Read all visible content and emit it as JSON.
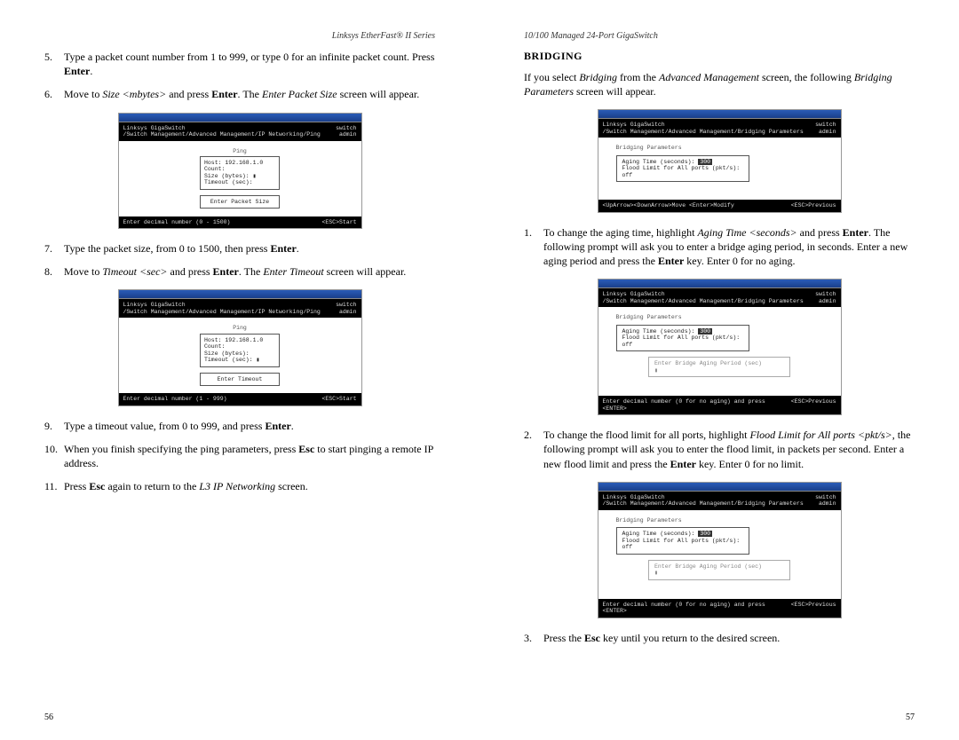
{
  "left": {
    "running_head": "Linksys EtherFast® II Series",
    "page_num": "56",
    "steps": {
      "n5": "5.",
      "s5a": "Type a packet count number from 1 to 999, or type 0 for an infinite packet count. Press ",
      "s5b": "Enter",
      "s5c": ".",
      "n6": "6.",
      "s6a": "Move to ",
      "s6b": "Size <mbytes>",
      "s6c": " and press ",
      "s6d": "Enter",
      "s6e": ". The ",
      "s6f": "Enter Packet Size",
      "s6g": " screen will appear.",
      "n7": "7.",
      "s7a": "Type the packet size, from 0 to 1500, then press ",
      "s7b": "Enter",
      "s7c": ".",
      "n8": "8.",
      "s8a": "Move to ",
      "s8b": "Timeout <sec>",
      "s8c": " and press ",
      "s8d": "Enter",
      "s8e": ". The ",
      "s8f": "Enter Timeout",
      "s8g": " screen will appear.",
      "n9": "9.",
      "s9a": "Type a timeout value, from 0 to 999, and press ",
      "s9b": "Enter",
      "s9c": ".",
      "n10": "10.",
      "s10a": "When you finish specifying the ping parameters, press ",
      "s10b": "Esc",
      "s10c": " to start pinging a remote IP address.",
      "n11": "11.",
      "s11a": "Press ",
      "s11b": "Esc",
      "s11c": " again to return to the ",
      "s11d": "L3 IP Networking",
      "s11e": " screen."
    },
    "ss1": {
      "head_l": "Linksys GigaSwitch\n/Switch Management/Advanced Management/IP Networking/Ping",
      "head_r": "switch\nadmin",
      "label": "Ping",
      "box1": "Host: 192.168.1.0\nCount:\nSize (bytes): ▮\nTimeout (sec):",
      "box2": "Enter Packet Size",
      "foot_l": "Enter decimal number (0 - 1500)",
      "foot_r": "<ESC>Start"
    },
    "ss2": {
      "head_l": "Linksys GigaSwitch\n/Switch Management/Advanced Management/IP Networking/Ping",
      "head_r": "switch\nadmin",
      "label": "Ping",
      "box1": "Host: 192.168.1.0\nCount:\nSize (bytes):\nTimeout (sec): ▮",
      "box2": "Enter Timeout",
      "foot_l": "Enter decimal number (1 - 999)",
      "foot_r": "<ESC>Start"
    }
  },
  "right": {
    "running_head": "10/100 Managed 24-Port GigaSwitch",
    "page_num": "57",
    "heading": "BRIDGING",
    "intro_a": "If you select ",
    "intro_b": "Bridging",
    "intro_c": " from the ",
    "intro_d": "Advanced Management",
    "intro_e": " screen, the following ",
    "intro_f": "Bridging Parameters",
    "intro_g": " screen will appear.",
    "steps": {
      "n1": "1.",
      "s1a": "To change the aging time, highlight ",
      "s1b": "Aging Time <seconds>",
      "s1c": " and press ",
      "s1d": "Enter",
      "s1e": ". The following prompt will ask you to enter a bridge aging period, in seconds. Enter a new aging period and press the ",
      "s1f": "Enter",
      "s1g": " key. Enter 0 for no aging.",
      "n2": "2.",
      "s2a": "To change the flood limit for all ports, highlight ",
      "s2b": "Flood Limit for All ports <pkt/s>",
      "s2c": ", the following prompt will ask you to enter the flood limit, in packets per second. Enter a new flood limit and press the ",
      "s2d": "Enter",
      "s2e": " key. Enter 0 for no limit.",
      "n3": "3.",
      "s3a": "Press the ",
      "s3b": "Esc",
      "s3c": " key until you return to the desired screen."
    },
    "ssA": {
      "head_l": "Linksys GigaSwitch\n/Switch Management/Advanced Management/Bridging Parameters",
      "head_r": "switch\nadmin",
      "label": "Bridging Parameters",
      "box1a": "Aging Time (seconds): ",
      "box1hl": "300",
      "box1b": "\nFlood Limit for All ports (pkt/s): off",
      "foot_l": "<UpArrow><DownArrow>Move  <Enter>Modify",
      "foot_r": "<ESC>Previous"
    },
    "ssB": {
      "head_l": "Linksys GigaSwitch\n/Switch Management/Advanced Management/Bridging Parameters",
      "head_r": "switch\nadmin",
      "label": "Bridging Parameters",
      "box1a": "Aging Time (seconds): ",
      "box1hl": "300",
      "box1b": "\nFlood Limit for All ports (pkt/s): off",
      "box2": "Enter Bridge Aging Period (sec)\n▮",
      "foot_l": "Enter decimal number (0 for no aging) and press <ENTER>",
      "foot_r": "<ESC>Previous"
    },
    "ssC": {
      "head_l": "Linksys GigaSwitch\n/Switch Management/Advanced Management/Bridging Parameters",
      "head_r": "switch\nadmin",
      "label": "Bridging Parameters",
      "box1a": "Aging Time (seconds): ",
      "box1hl": "300",
      "box1b": "\nFlood Limit for All ports (pkt/s): off",
      "box2": "Enter Bridge Aging Period (sec)\n▮",
      "foot_l": "Enter decimal number (0 for no aging) and press <ENTER>",
      "foot_r": "<ESC>Previous"
    }
  }
}
